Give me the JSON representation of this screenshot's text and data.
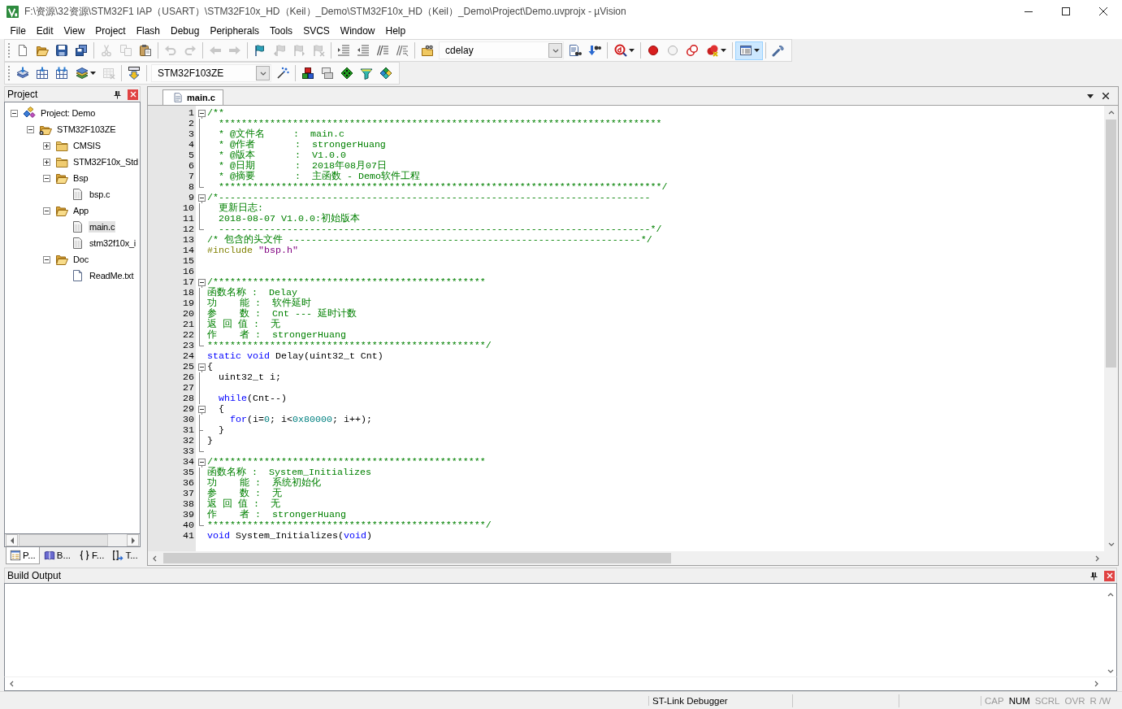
{
  "window": {
    "title": "F:\\资源\\32资源\\STM32F1 IAP（USART）\\STM32F10x_HD（Keil）_Demo\\STM32F10x_HD（Keil）_Demo\\Project\\Demo.uvprojx - µVision"
  },
  "menu": [
    "File",
    "Edit",
    "View",
    "Project",
    "Flash",
    "Debug",
    "Peripherals",
    "Tools",
    "SVCS",
    "Window",
    "Help"
  ],
  "toolbars": [
    {
      "groups": [
        [
          {
            "kind": "new",
            "disabled": false,
            "dropdown": false,
            "pressed": false
          },
          {
            "kind": "open",
            "disabled": false,
            "dropdown": false,
            "pressed": false
          },
          {
            "kind": "save",
            "disabled": false,
            "dropdown": false,
            "pressed": false
          },
          {
            "kind": "save-all",
            "disabled": false,
            "dropdown": false,
            "pressed": false
          }
        ],
        [
          {
            "kind": "cut",
            "disabled": true,
            "dropdown": false,
            "pressed": false
          },
          {
            "kind": "copy",
            "disabled": true,
            "dropdown": false,
            "pressed": false
          },
          {
            "kind": "paste",
            "disabled": false,
            "dropdown": false,
            "pressed": false
          }
        ],
        [
          {
            "kind": "undo",
            "disabled": true,
            "dropdown": false,
            "pressed": false
          },
          {
            "kind": "redo",
            "disabled": true,
            "dropdown": false,
            "pressed": false
          }
        ],
        [
          {
            "kind": "back",
            "disabled": true,
            "dropdown": false,
            "pressed": false
          },
          {
            "kind": "forward",
            "disabled": true,
            "dropdown": false,
            "pressed": false
          }
        ],
        [
          {
            "kind": "bookmark",
            "disabled": false,
            "dropdown": false,
            "pressed": false
          },
          {
            "kind": "bookmark-prev",
            "disabled": true,
            "dropdown": false,
            "pressed": false
          },
          {
            "kind": "bookmark-next",
            "disabled": true,
            "dropdown": false,
            "pressed": false
          },
          {
            "kind": "bookmark-clear",
            "disabled": true,
            "dropdown": false,
            "pressed": false
          }
        ],
        [
          {
            "kind": "indent",
            "disabled": false,
            "dropdown": false,
            "pressed": false
          },
          {
            "kind": "unindent",
            "disabled": false,
            "dropdown": false,
            "pressed": false
          },
          {
            "kind": "comment",
            "disabled": false,
            "dropdown": false,
            "pressed": false
          },
          {
            "kind": "uncomment",
            "disabled": false,
            "dropdown": false,
            "pressed": false
          }
        ],
        [
          {
            "kind": "find-in-files",
            "disabled": false,
            "dropdown": false,
            "pressed": false
          },
          {
            "kind": "combo",
            "value": "cdelay"
          },
          {
            "kind": "find",
            "disabled": false,
            "dropdown": false,
            "pressed": false
          },
          {
            "kind": "incremental-find",
            "disabled": false,
            "dropdown": false,
            "pressed": false
          }
        ],
        [
          {
            "kind": "debug",
            "disabled": false,
            "dropdown": true,
            "pressed": false
          }
        ],
        [
          {
            "kind": "breakpoint",
            "disabled": false,
            "dropdown": false,
            "pressed": false
          },
          {
            "kind": "breakpoint-disable",
            "disabled": false,
            "dropdown": false,
            "pressed": false
          },
          {
            "kind": "breakpoint-disable-all",
            "disabled": false,
            "dropdown": false,
            "pressed": false
          },
          {
            "kind": "breakpoint-kill",
            "disabled": false,
            "dropdown": true,
            "pressed": false
          }
        ],
        [
          {
            "kind": "window",
            "disabled": false,
            "dropdown": true,
            "pressed": true
          }
        ],
        [
          {
            "kind": "configure",
            "disabled": false,
            "dropdown": false,
            "pressed": false
          }
        ]
      ]
    },
    {
      "groups": [
        [
          {
            "kind": "translate",
            "disabled": false,
            "dropdown": false,
            "pressed": false
          },
          {
            "kind": "build",
            "disabled": false,
            "dropdown": false,
            "pressed": false
          },
          {
            "kind": "rebuild",
            "disabled": false,
            "dropdown": false,
            "pressed": false
          },
          {
            "kind": "batch-build",
            "disabled": false,
            "dropdown": true,
            "pressed": false
          },
          {
            "kind": "stop-build",
            "disabled": true,
            "dropdown": false,
            "pressed": false
          }
        ],
        [
          {
            "kind": "download",
            "disabled": false,
            "dropdown": false,
            "pressed": false
          }
        ],
        [
          {
            "kind": "combo",
            "value": "STM32F103ZE"
          },
          {
            "kind": "options",
            "disabled": false,
            "dropdown": false,
            "pressed": false
          }
        ],
        [
          {
            "kind": "manage",
            "disabled": false,
            "dropdown": false,
            "pressed": false
          },
          {
            "kind": "packs",
            "disabled": false,
            "dropdown": false,
            "pressed": false
          },
          {
            "kind": "rte",
            "disabled": false,
            "dropdown": false,
            "pressed": false
          },
          {
            "kind": "filter",
            "disabled": false,
            "dropdown": false,
            "pressed": false
          },
          {
            "kind": "installer",
            "disabled": false,
            "dropdown": false,
            "pressed": false
          }
        ]
      ]
    }
  ],
  "project": {
    "title": "Project",
    "tree": [
      {
        "label": "Project: Demo",
        "kind": "project",
        "expanded": true,
        "selected": false,
        "children": [
          {
            "label": "STM32F103ZE",
            "kind": "target",
            "expanded": true,
            "selected": false,
            "children": [
              {
                "label": "CMSIS",
                "kind": "group",
                "expanded": false,
                "selected": false
              },
              {
                "label": "STM32F10x_Std",
                "kind": "group",
                "expanded": false,
                "selected": false
              },
              {
                "label": "Bsp",
                "kind": "group",
                "expanded": true,
                "selected": false,
                "children": [
                  {
                    "label": "bsp.c",
                    "kind": "file",
                    "selected": false
                  }
                ]
              },
              {
                "label": "App",
                "kind": "group",
                "expanded": true,
                "selected": false,
                "children": [
                  {
                    "label": "main.c",
                    "kind": "file",
                    "selected": true
                  },
                  {
                    "label": "stm32f10x_i",
                    "kind": "file",
                    "selected": false
                  }
                ]
              },
              {
                "label": "Doc",
                "kind": "group",
                "expanded": true,
                "selected": false,
                "children": [
                  {
                    "label": "ReadMe.txt",
                    "kind": "text-file",
                    "selected": false
                  }
                ]
              }
            ]
          }
        ]
      }
    ],
    "tabs": [
      {
        "label": "P...",
        "kind": "project",
        "selected": true
      },
      {
        "label": "B...",
        "kind": "books",
        "selected": false
      },
      {
        "label": "F...",
        "kind": "functions",
        "selected": false
      },
      {
        "label": "T...",
        "kind": "templates",
        "selected": false
      }
    ]
  },
  "editor": {
    "tabs": [
      {
        "label": "main.c",
        "selected": true
      }
    ],
    "lines": [
      {
        "number": "1",
        "kind": "fold-start",
        "tokens": [
          {
            "kind": "comment",
            "text": "/**"
          }
        ]
      },
      {
        "number": "2",
        "kind": "fold-body",
        "tokens": [
          {
            "kind": "comment",
            "text": "  ******************************************************************************"
          }
        ]
      },
      {
        "number": "3",
        "kind": "fold-body",
        "tokens": [
          {
            "kind": "comment",
            "text": "  * @文件名     :  main.c"
          }
        ]
      },
      {
        "number": "4",
        "kind": "fold-body",
        "tokens": [
          {
            "kind": "comment",
            "text": "  * @作者       :  strongerHuang"
          }
        ]
      },
      {
        "number": "5",
        "kind": "fold-body",
        "tokens": [
          {
            "kind": "comment",
            "text": "  * @版本       :  V1.0.0"
          }
        ]
      },
      {
        "number": "6",
        "kind": "fold-body",
        "tokens": [
          {
            "kind": "comment",
            "text": "  * @日期       :  2018年08月07日"
          }
        ]
      },
      {
        "number": "7",
        "kind": "fold-body",
        "tokens": [
          {
            "kind": "comment",
            "text": "  * @摘要       :  主函数 - Demo软件工程"
          }
        ]
      },
      {
        "number": "8",
        "kind": "fold-end",
        "tokens": [
          {
            "kind": "comment",
            "text": "  ******************************************************************************/"
          }
        ]
      },
      {
        "number": "9",
        "kind": "fold-start",
        "tokens": [
          {
            "kind": "comment",
            "text": "/*----------------------------------------------------------------------------"
          }
        ]
      },
      {
        "number": "10",
        "kind": "fold-body",
        "tokens": [
          {
            "kind": "comment",
            "text": "  更新日志:"
          }
        ]
      },
      {
        "number": "11",
        "kind": "fold-body",
        "tokens": [
          {
            "kind": "comment",
            "text": "  2018-08-07 V1.0.0:初始版本"
          }
        ]
      },
      {
        "number": "12",
        "kind": "fold-end",
        "tokens": [
          {
            "kind": "comment",
            "text": "  ----------------------------------------------------------------------------*/"
          }
        ]
      },
      {
        "number": "13",
        "kind": "plain",
        "tokens": [
          {
            "kind": "comment",
            "text": "/* 包含的头文件 --------------------------------------------------------------*/"
          }
        ]
      },
      {
        "number": "14",
        "kind": "plain",
        "tokens": [
          {
            "kind": "preprocessor",
            "text": "#include "
          },
          {
            "kind": "string",
            "text": "\"bsp.h\""
          }
        ]
      },
      {
        "number": "15",
        "kind": "plain"
      },
      {
        "number": "16",
        "kind": "plain"
      },
      {
        "number": "17",
        "kind": "fold-start",
        "tokens": [
          {
            "kind": "comment",
            "text": "/************************************************"
          }
        ]
      },
      {
        "number": "18",
        "kind": "fold-body",
        "tokens": [
          {
            "kind": "comment",
            "text": "函数名称 :  Delay"
          }
        ]
      },
      {
        "number": "19",
        "kind": "fold-body",
        "tokens": [
          {
            "kind": "comment",
            "text": "功    能 :  软件延时"
          }
        ]
      },
      {
        "number": "20",
        "kind": "fold-body",
        "tokens": [
          {
            "kind": "comment",
            "text": "参    数 :  Cnt --- 延时计数"
          }
        ]
      },
      {
        "number": "21",
        "kind": "fold-body",
        "tokens": [
          {
            "kind": "comment",
            "text": "返 回 值 :  无"
          }
        ]
      },
      {
        "number": "22",
        "kind": "fold-body",
        "tokens": [
          {
            "kind": "comment",
            "text": "作    者 :  strongerHuang"
          }
        ]
      },
      {
        "number": "23",
        "kind": "fold-end",
        "tokens": [
          {
            "kind": "comment",
            "text": "*************************************************/"
          }
        ]
      },
      {
        "number": "24",
        "kind": "plain",
        "tokens": [
          {
            "kind": "keyword",
            "text": "static "
          },
          {
            "kind": "keyword",
            "text": "void"
          },
          {
            "kind": "text",
            "text": " Delay(uint32_t Cnt)"
          }
        ]
      },
      {
        "number": "25",
        "kind": "fold-start",
        "tokens": [
          {
            "kind": "text",
            "text": "{"
          }
        ]
      },
      {
        "number": "26",
        "kind": "fold-body",
        "tokens": [
          {
            "kind": "text",
            "text": "  uint32_t i;"
          }
        ]
      },
      {
        "number": "27",
        "kind": "fold-body"
      },
      {
        "number": "28",
        "kind": "fold-body",
        "tokens": [
          {
            "kind": "keyword",
            "text": "  while"
          },
          {
            "kind": "text",
            "text": "(Cnt--)"
          }
        ]
      },
      {
        "number": "29",
        "kind": "fold-start",
        "tokens": [
          {
            "kind": "text",
            "text": "  {"
          }
        ]
      },
      {
        "number": "30",
        "kind": "fold-body",
        "tokens": [
          {
            "kind": "keyword",
            "text": "    for"
          },
          {
            "kind": "text",
            "text": "(i="
          },
          {
            "kind": "number",
            "text": "0"
          },
          {
            "kind": "text",
            "text": "; i<"
          },
          {
            "kind": "number",
            "text": "0x80000"
          },
          {
            "kind": "text",
            "text": "; i++);"
          }
        ]
      },
      {
        "number": "31",
        "kind": "fold-branch",
        "tokens": [
          {
            "kind": "text",
            "text": "  }"
          }
        ]
      },
      {
        "number": "32",
        "kind": "fold-body",
        "tokens": [
          {
            "kind": "text",
            "text": "}"
          }
        ]
      },
      {
        "number": "33",
        "kind": "fold-end"
      },
      {
        "number": "34",
        "kind": "fold-start",
        "tokens": [
          {
            "kind": "comment",
            "text": "/************************************************"
          }
        ]
      },
      {
        "number": "35",
        "kind": "fold-body",
        "tokens": [
          {
            "kind": "comment",
            "text": "函数名称 :  System_Initializes"
          }
        ]
      },
      {
        "number": "36",
        "kind": "fold-body",
        "tokens": [
          {
            "kind": "comment",
            "text": "功    能 :  系统初始化"
          }
        ]
      },
      {
        "number": "37",
        "kind": "fold-body",
        "tokens": [
          {
            "kind": "comment",
            "text": "参    数 :  无"
          }
        ]
      },
      {
        "number": "38",
        "kind": "fold-body",
        "tokens": [
          {
            "kind": "comment",
            "text": "返 回 值 :  无"
          }
        ]
      },
      {
        "number": "39",
        "kind": "fold-body",
        "tokens": [
          {
            "kind": "comment",
            "text": "作    者 :  strongerHuang"
          }
        ]
      },
      {
        "number": "40",
        "kind": "fold-end",
        "tokens": [
          {
            "kind": "comment",
            "text": "*************************************************/"
          }
        ]
      },
      {
        "number": "41",
        "kind": "plain",
        "tokens": [
          {
            "kind": "keyword",
            "text": "void"
          },
          {
            "kind": "text",
            "text": " System_Initializes("
          },
          {
            "kind": "keyword",
            "text": "void"
          },
          {
            "kind": "text",
            "text": ")"
          }
        ]
      }
    ]
  },
  "build_output": {
    "title": "Build Output"
  },
  "status_bar": {
    "items": [
      {
        "text": "ST-Link Debugger"
      }
    ],
    "indicators": [
      {
        "text": "CAP",
        "on": false
      },
      {
        "text": "NUM",
        "on": true
      },
      {
        "text": "SCRL",
        "on": false
      },
      {
        "text": "OVR",
        "on": false
      },
      {
        "text": "R /W",
        "on": false
      }
    ]
  }
}
